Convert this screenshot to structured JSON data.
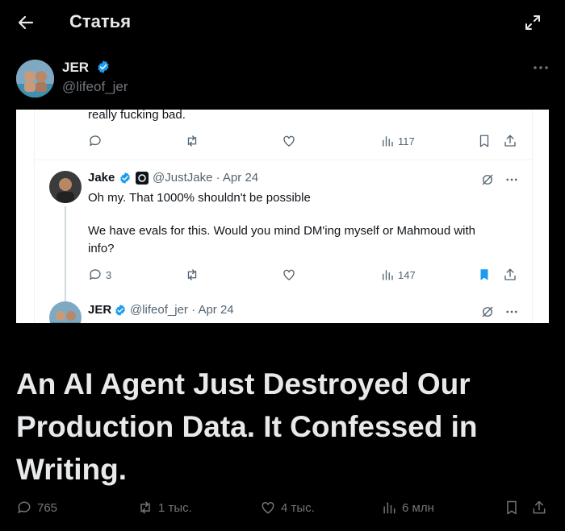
{
  "header": {
    "title": "Статья"
  },
  "author": {
    "name": "JER",
    "handle": "@lifeof_jer"
  },
  "embed": {
    "partial_text": "really fucking bad.",
    "tweet1_actions": {
      "views": "117"
    },
    "reply": {
      "name": "Jake",
      "handle": "@JustJake",
      "date": "· Apr 24",
      "line1": "Oh my. That 1000% shouldn't be possible",
      "line2": "We have evals for this. Would you mind DM'ing myself or Mahmoud with",
      "line3": "info?",
      "replies": "3",
      "views": "147"
    },
    "next": {
      "name": "JER",
      "handle": "@lifeof_jer",
      "date": "· Apr 24"
    }
  },
  "headline": "An AI Agent Just Destroyed Our Production Data. It Confessed in Writing.",
  "stats": {
    "replies": "765",
    "reposts": "1 тыс.",
    "likes": "4 тыс.",
    "views": "6 млн"
  },
  "colors": {
    "background": "#000000",
    "text": "#e7e9ea",
    "muted": "#71767b",
    "verified": "#1d9bf0"
  }
}
